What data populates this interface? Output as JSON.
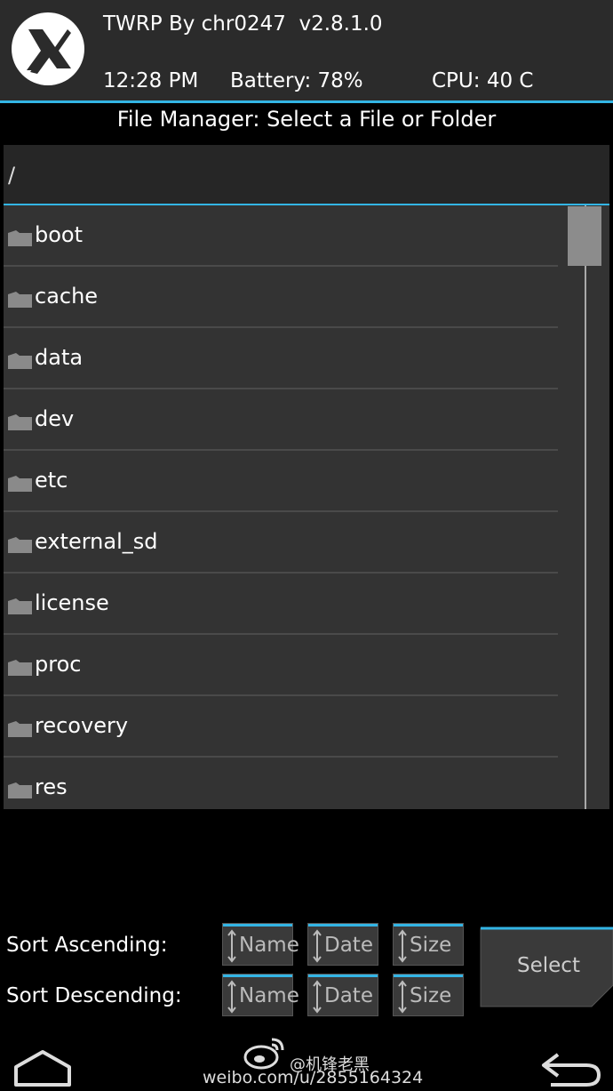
{
  "header": {
    "title": "TWRP By chr0247  v2.8.1.0",
    "time": "12:28 PM",
    "battery": "Battery: 78%",
    "cpu": "CPU: 40 C",
    "logo_icon": "twrp-logo-icon"
  },
  "file_manager": {
    "title": "File Manager: Select a File or Folder",
    "path": "/",
    "items": [
      {
        "label": "boot",
        "icon": "folder-icon"
      },
      {
        "label": "cache",
        "icon": "folder-icon"
      },
      {
        "label": "data",
        "icon": "folder-icon"
      },
      {
        "label": "dev",
        "icon": "folder-icon"
      },
      {
        "label": "etc",
        "icon": "folder-icon"
      },
      {
        "label": "external_sd",
        "icon": "folder-icon"
      },
      {
        "label": "license",
        "icon": "folder-icon"
      },
      {
        "label": "proc",
        "icon": "folder-icon"
      },
      {
        "label": "recovery",
        "icon": "folder-icon"
      },
      {
        "label": "res",
        "icon": "folder-icon"
      }
    ]
  },
  "sort": {
    "ascending_label": "Sort Ascending:",
    "descending_label": "Sort Descending:",
    "name": "Name",
    "date": "Date",
    "size": "Size"
  },
  "select_button": "Select",
  "watermark": {
    "handle": "@机锋老黑",
    "url": "weibo.com/u/2855164324"
  },
  "colors": {
    "accent": "#33b5e5",
    "header_bg": "#2b2b2b",
    "list_bg": "#333333"
  }
}
